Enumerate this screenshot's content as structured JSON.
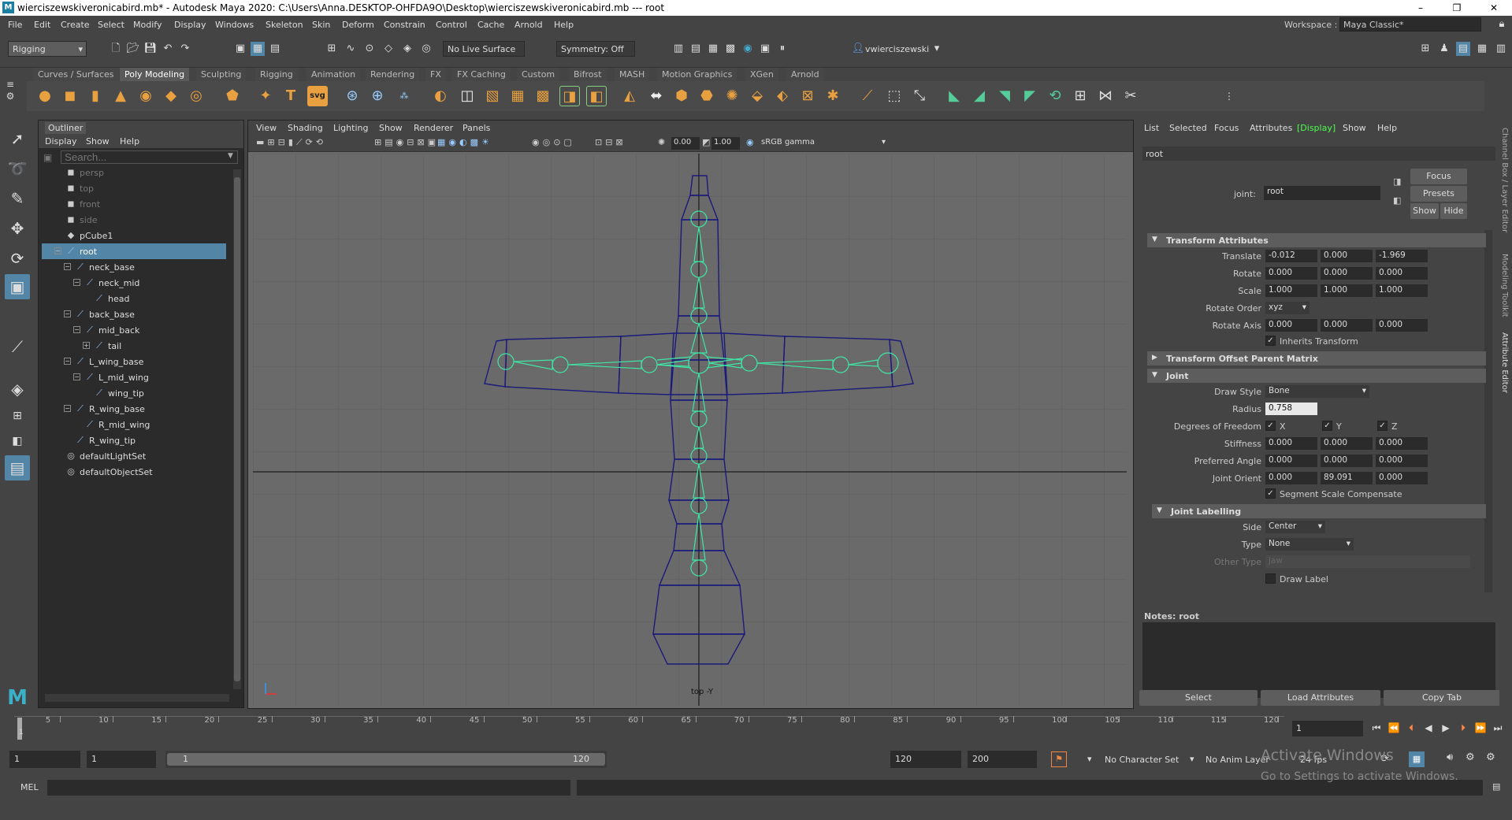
{
  "window": {
    "title": "wierciszewskiveronicabird.mb* - Autodesk Maya 2020: C:\\Users\\Anna.DESKTOP-OHFDA9O\\Desktop\\wierciszewskiveronicabird.mb   ---   root",
    "logo": "M",
    "minimize": "–",
    "maximize": "❐",
    "close": "✕"
  },
  "menubar": {
    "items": [
      "File",
      "Edit",
      "Create",
      "Select",
      "Modify",
      "Display",
      "Windows",
      "Skeleton",
      "Skin",
      "Deform",
      "Constrain",
      "Control",
      "Cache",
      "Arnold",
      "Help"
    ],
    "workspace_label": "Workspace :",
    "workspace_value": "Maya Classic*"
  },
  "statusline": {
    "menuset": "Rigging",
    "live_surface": "No Live Surface",
    "symmetry": "Symmetry: Off",
    "user": "vwierciszewski"
  },
  "shelf": {
    "tabs": [
      "Curves / Surfaces",
      "Poly Modeling",
      "Sculpting",
      "Rigging",
      "Animation",
      "Rendering",
      "FX",
      "FX Caching",
      "Custom",
      "Bifrost",
      "MASH",
      "Motion Graphics",
      "XGen",
      "Arnold"
    ],
    "active_tab": "Poly Modeling",
    "svg_label": "svg",
    "text_icon": "T"
  },
  "outliner": {
    "title": "Outliner",
    "menu": [
      "Display",
      "Show",
      "Help"
    ],
    "search_placeholder": "Search...",
    "items": [
      {
        "label": "persp",
        "icon": "camera-icon",
        "glyph": "◼",
        "depth": 0,
        "dim": true,
        "selected": false,
        "expand": ""
      },
      {
        "label": "top",
        "icon": "camera-icon",
        "glyph": "◼",
        "depth": 0,
        "dim": true,
        "selected": false,
        "expand": ""
      },
      {
        "label": "front",
        "icon": "camera-icon",
        "glyph": "◼",
        "depth": 0,
        "dim": true,
        "selected": false,
        "expand": ""
      },
      {
        "label": "side",
        "icon": "camera-icon",
        "glyph": "◼",
        "depth": 0,
        "dim": true,
        "selected": false,
        "expand": ""
      },
      {
        "label": "pCube1",
        "icon": "mesh-icon",
        "glyph": "◆",
        "depth": 0,
        "dim": false,
        "selected": false,
        "expand": ""
      },
      {
        "label": "root",
        "icon": "joint-icon",
        "glyph": "⟋",
        "depth": 0,
        "dim": false,
        "selected": true,
        "expand": "−"
      },
      {
        "label": "neck_base",
        "icon": "joint-icon",
        "glyph": "⟋",
        "depth": 1,
        "dim": false,
        "selected": false,
        "expand": "−"
      },
      {
        "label": "neck_mid",
        "icon": "joint-icon",
        "glyph": "⟋",
        "depth": 2,
        "dim": false,
        "selected": false,
        "expand": "−"
      },
      {
        "label": "head",
        "icon": "joint-icon",
        "glyph": "⟋",
        "depth": 3,
        "dim": false,
        "selected": false,
        "expand": ""
      },
      {
        "label": "back_base",
        "icon": "joint-icon",
        "glyph": "⟋",
        "depth": 1,
        "dim": false,
        "selected": false,
        "expand": "−"
      },
      {
        "label": "mid_back",
        "icon": "joint-icon",
        "glyph": "⟋",
        "depth": 2,
        "dim": false,
        "selected": false,
        "expand": "−"
      },
      {
        "label": "tail",
        "icon": "joint-icon",
        "glyph": "⟋",
        "depth": 3,
        "dim": false,
        "selected": false,
        "expand": "+"
      },
      {
        "label": "L_wing_base",
        "icon": "joint-icon",
        "glyph": "⟋",
        "depth": 1,
        "dim": false,
        "selected": false,
        "expand": "−"
      },
      {
        "label": "L_mid_wing",
        "icon": "joint-icon",
        "glyph": "⟋",
        "depth": 2,
        "dim": false,
        "selected": false,
        "expand": "−"
      },
      {
        "label": "wing_tip",
        "icon": "joint-icon",
        "glyph": "⟋",
        "depth": 3,
        "dim": false,
        "selected": false,
        "expand": ""
      },
      {
        "label": "R_wing_base",
        "icon": "joint-icon",
        "glyph": "⟋",
        "depth": 1,
        "dim": false,
        "selected": false,
        "expand": "−"
      },
      {
        "label": "R_mid_wing",
        "icon": "joint-icon",
        "glyph": "⟋",
        "depth": 2,
        "dim": false,
        "selected": false,
        "expand": ""
      },
      {
        "label": "R_wing_tip",
        "icon": "joint-icon",
        "glyph": "⟋",
        "depth": 1,
        "dim": false,
        "selected": false,
        "expand": ""
      },
      {
        "label": "defaultLightSet",
        "icon": "set-icon",
        "glyph": "◎",
        "depth": 0,
        "dim": false,
        "selected": false,
        "expand": ""
      },
      {
        "label": "defaultObjectSet",
        "icon": "set-icon",
        "glyph": "◎",
        "depth": 0,
        "dim": false,
        "selected": false,
        "expand": ""
      }
    ]
  },
  "viewport": {
    "menu": [
      "View",
      "Shading",
      "Lighting",
      "Show",
      "Renderer",
      "Panels"
    ],
    "exposure": "0.00",
    "gamma": "1.00",
    "color_space": "sRGB gamma",
    "camera_label": "top -Y"
  },
  "attribute_editor": {
    "menu": [
      "List",
      "Selected",
      "Focus",
      "Attributes",
      "[Display]",
      "Show",
      "Help"
    ],
    "tab": "root",
    "node_label": "joint:",
    "node_name": "root",
    "buttons": {
      "focus": "Focus",
      "presets": "Presets",
      "show": "Show",
      "hide": "Hide"
    },
    "sections": {
      "transform": "Transform Attributes",
      "offset": "Transform Offset Parent Matrix",
      "joint": "Joint",
      "labelling": "Joint Labelling"
    },
    "transform": {
      "translate": {
        "label": "Translate",
        "x": "-0.012",
        "y": "0.000",
        "z": "-1.969"
      },
      "rotate": {
        "label": "Rotate",
        "x": "0.000",
        "y": "0.000",
        "z": "0.000"
      },
      "scale": {
        "label": "Scale",
        "x": "1.000",
        "y": "1.000",
        "z": "1.000"
      },
      "rotate_order": {
        "label": "Rotate Order",
        "value": "xyz"
      },
      "rotate_axis": {
        "label": "Rotate Axis",
        "x": "0.000",
        "y": "0.000",
        "z": "0.000"
      },
      "inherits": "Inherits Transform"
    },
    "joint": {
      "draw_style": {
        "label": "Draw Style",
        "value": "Bone"
      },
      "radius": {
        "label": "Radius",
        "value": "0.758"
      },
      "dof": {
        "label": "Degrees of Freedom",
        "x": "X",
        "y": "Y",
        "z": "Z"
      },
      "stiffness": {
        "label": "Stiffness",
        "x": "0.000",
        "y": "0.000",
        "z": "0.000"
      },
      "preferred": {
        "label": "Preferred Angle",
        "x": "0.000",
        "y": "0.000",
        "z": "0.000"
      },
      "orient": {
        "label": "Joint Orient",
        "x": "0.000",
        "y": "89.091",
        "z": "0.000"
      },
      "ssc": "Segment Scale Compensate"
    },
    "labelling": {
      "side": {
        "label": "Side",
        "value": "Center"
      },
      "type": {
        "label": "Type",
        "value": "None"
      },
      "other": {
        "label": "Other Type",
        "value": "jaw"
      },
      "draw_label": "Draw Label"
    },
    "notes_label": "Notes:  root",
    "bottom_buttons": {
      "select": "Select",
      "load": "Load Attributes",
      "copy": "Copy Tab"
    }
  },
  "side_tabs": [
    "Channel Box / Layer Editor",
    "Modeling Toolkit",
    "Attribute Editor"
  ],
  "timeline": {
    "ticks": [
      "5",
      "10",
      "15",
      "20",
      "25",
      "30",
      "35",
      "40",
      "45",
      "50",
      "55",
      "60",
      "65",
      "70",
      "75",
      "80",
      "85",
      "90",
      "95",
      "100",
      "105",
      "110",
      "115",
      "120"
    ],
    "start_marker": "1",
    "current_frame": "1"
  },
  "range": {
    "start": "1",
    "playback_start": "1",
    "slider_start": "1",
    "slider_end": "120",
    "playback_end": "120",
    "end": "200",
    "character_set": "No Character Set",
    "anim_layer": "No Anim Layer",
    "fps": "24 fps"
  },
  "cmdline": {
    "label": "MEL"
  },
  "watermark": {
    "line1": "Activate Windows",
    "line2": "Go to Settings to activate Windows."
  }
}
